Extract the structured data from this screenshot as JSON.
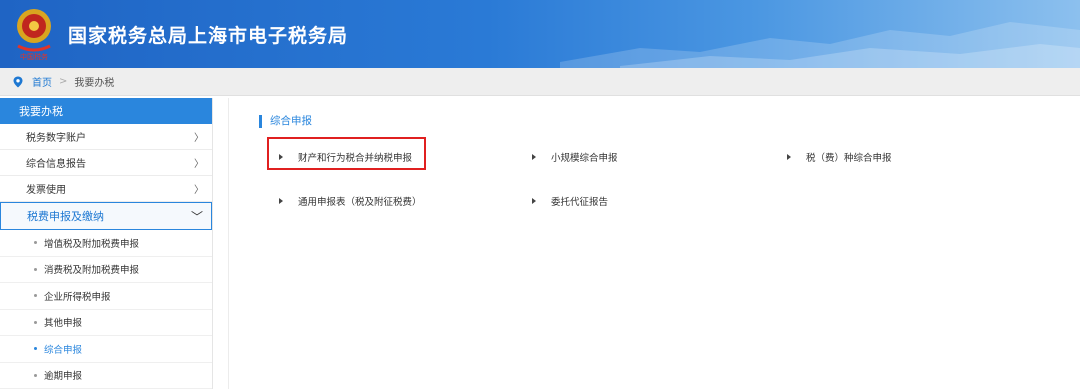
{
  "header": {
    "title": "国家税务总局上海市电子税务局",
    "emblem_text": "中国税务"
  },
  "breadcrumb": {
    "home": "首页",
    "current": "我要办税"
  },
  "sidebar": {
    "heading": "我要办税",
    "items": [
      {
        "label": "税务数字账户",
        "arrow": "〉"
      },
      {
        "label": "综合信息报告",
        "arrow": "〉"
      },
      {
        "label": "发票使用",
        "arrow": "〉"
      }
    ],
    "active_item": {
      "label": "税费申报及缴纳",
      "arrow": "﹀"
    },
    "subitems": [
      {
        "label": "增值税及附加税费申报"
      },
      {
        "label": "消费税及附加税费申报"
      },
      {
        "label": "企业所得税申报"
      },
      {
        "label": "其他申报"
      },
      {
        "label": "综合申报"
      },
      {
        "label": "逾期申报"
      }
    ]
  },
  "main": {
    "section_title": "综合申报",
    "links": [
      {
        "label": "财产和行为税合并纳税申报"
      },
      {
        "label": "小规模综合申报"
      },
      {
        "label": "税（费）种综合申报"
      },
      {
        "label": "通用申报表（税及附征税费）"
      },
      {
        "label": "委托代征报告"
      }
    ]
  },
  "colors": {
    "accent": "#2a86dd",
    "highlight_box": "#e02020",
    "header_blue": "#1f64c4"
  }
}
